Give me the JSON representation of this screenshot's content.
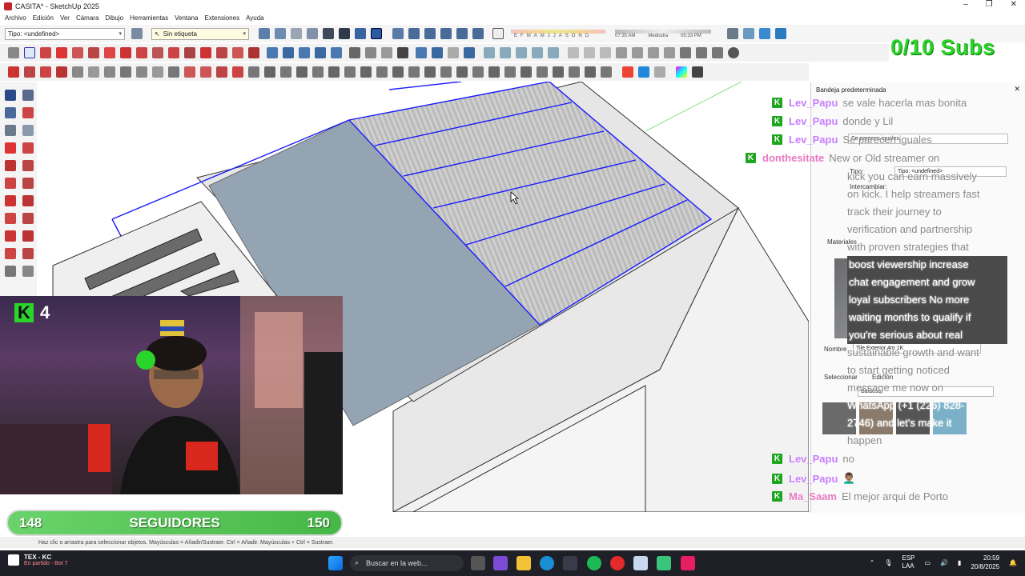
{
  "window": {
    "title": "CASITA* - SketchUp 2025",
    "controls": [
      "–",
      "❐",
      "✕"
    ]
  },
  "menu": [
    "Archivo",
    "Edición",
    "Ver",
    "Cámara",
    "Dibujo",
    "Herramientas",
    "Ventana",
    "Extensiones",
    "Ayuda"
  ],
  "toolbar": {
    "type_select": "Tipo: <undefined>",
    "tag_select": "Sin etiqueta",
    "shadow_months": [
      "E",
      "F",
      "M",
      "A",
      "M",
      "J",
      "J",
      "A",
      "S",
      "O",
      "N",
      "D"
    ],
    "time_start": "07:35 AM",
    "time_mid": "Mediodía",
    "time_end": "05:33 PM"
  },
  "overlay": {
    "subs_goal": "0/10 Subs",
    "webcam_count": "4",
    "followers_current": "148",
    "followers_label": "SEGUIDORES",
    "followers_goal": "150"
  },
  "tray": {
    "title": "Bandeja predeterminada",
    "entity_info_select": "Se parecen iguales",
    "tipo_label": "Tipo:",
    "tipo_value": "Tipo: <undefined>",
    "intercambiar_label": "Intercambiar:",
    "materials_header": "Materiales",
    "nombre_label": "Nombre",
    "nombre_value": "Tile Exterior 4m 1K",
    "tab_select": "Seleccionar",
    "tab_edit": "Edición",
    "library_select": "Baldosa"
  },
  "chat": {
    "messages": [
      {
        "user": "Lev_Papu",
        "text": "se vale hacerla mas bonita"
      },
      {
        "user": "Lev_Papu",
        "text": "donde y Lil"
      },
      {
        "user": "Lev_Papu",
        "text": "Se parecen iguales"
      },
      {
        "user": "donthesitate",
        "text": "New or Old streamer on"
      },
      {
        "user": "Lev_Papu",
        "text": "no"
      },
      {
        "user": "Lev_Papu",
        "text": "👨🏽‍🦱"
      },
      {
        "user": "Ma_Saam",
        "text": "El mejor arqui de Porto"
      }
    ],
    "spam_lines": [
      "kick you can earn massively",
      "on kick. I help streamers fast",
      "track their journey to",
      "verification and partnership",
      "with proven strategies that",
      "boost viewership increase",
      "chat engagement and grow",
      "loyal subscribers No more",
      "waiting months to qualify if",
      "you're serious about real",
      "sustainable growth and want",
      "to start getting noticed",
      "message me now on",
      "WhatsApp (+1 (226) 828-",
      "2746) and let's make it",
      "happen"
    ]
  },
  "statusbar": {
    "hint": "Haz clic o arrastra para seleccionar objetos. Mayúsculas = Añadir/Sustraer. Ctrl = Añadir. Mayúsculas + Ctrl = Sustraer."
  },
  "taskbar": {
    "game_title": "TEX - KC",
    "game_status": "En partido - Bot 7",
    "search_placeholder": "Buscar en la web...",
    "lang_top": "ESP",
    "lang_bottom": "LAA",
    "time": "20:59",
    "date": "20/8/2025"
  },
  "colors": {
    "accent_green": "#2bd42b",
    "selection_blue": "#1a1aff",
    "roof_fill": "#94a4b2",
    "chat_user": "#c77dff"
  }
}
